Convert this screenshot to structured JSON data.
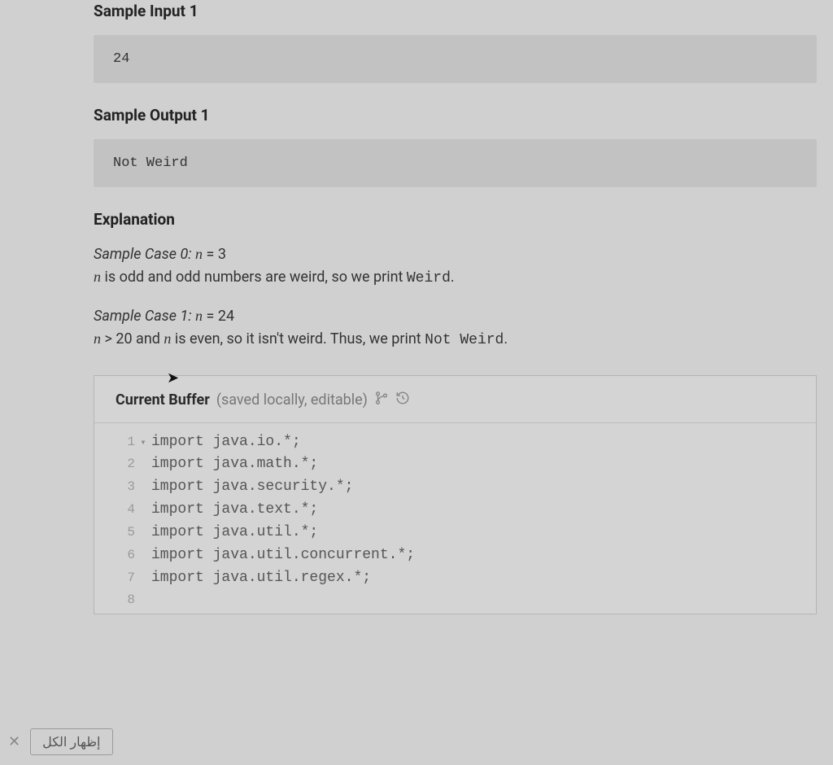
{
  "sample_input": {
    "heading": "Sample Input 1",
    "value": "24"
  },
  "sample_output": {
    "heading": "Sample Output 1",
    "value": "Not Weird"
  },
  "explanation": {
    "heading": "Explanation",
    "case0": {
      "label": "Sample Case 0: ",
      "eqL": "n",
      "eqOp": " = ",
      "eqR": "3",
      "line_pre": "n",
      "line_mid": " is odd and odd numbers are weird, so we print ",
      "line_code": "Weird",
      "line_post": "."
    },
    "case1": {
      "label": "Sample Case 1: ",
      "eqL": "n",
      "eqOp": " = ",
      "eqR": "24",
      "line_pre": "n",
      "line_op": " > ",
      "line_val": "20",
      "line_mid1": " and ",
      "line_var2": "n",
      "line_mid2": " is even, so it isn't weird. Thus, we print ",
      "line_code": "Not Weird",
      "line_post": "."
    }
  },
  "buffer": {
    "title_bold": "Current Buffer",
    "title_sub": " (saved locally, editable)",
    "lines": [
      "import java.io.*;",
      "import java.math.*;",
      "import java.security.*;",
      "import java.text.*;",
      "import java.util.*;",
      "import java.util.concurrent.*;",
      "import java.util.regex.*;",
      ""
    ]
  },
  "bottom": {
    "button": "إظهار الكل",
    "close": "✕"
  }
}
